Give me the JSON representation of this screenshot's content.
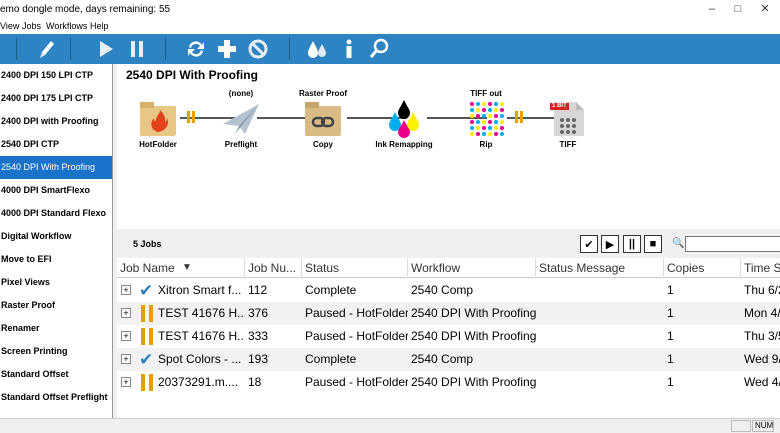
{
  "window": {
    "title": "emo dongle mode, days remaining: 55"
  },
  "menu": [
    "View",
    "Jobs",
    "Workflows",
    "Help"
  ],
  "workflows": [
    "2400 DPI 150 LPI CTP",
    "2400 DPI 175 LPI CTP",
    "2400 DPI with Proofing",
    "2540 DPI CTP",
    "2540 DPI With Proofing",
    "4000 DPI SmartFlexo",
    "4000 DPI Standard Flexo",
    "Digital Workflow",
    "Move to EFI",
    "Pixel Views",
    "Raster Proof",
    "Renamer",
    "Screen Printing",
    "Standard Offset",
    "Standard Offset Preflight"
  ],
  "selected_workflow": "2540 DPI With Proofing",
  "flow": {
    "title": "2540 DPI With Proofing",
    "nodes": [
      {
        "caption": "HotFolder",
        "label": "",
        "icon": "hotfolder-icon"
      },
      {
        "caption": "Preflight",
        "label": "(none)",
        "icon": "paper-plane-icon"
      },
      {
        "caption": "Copy",
        "label": "Raster Proof",
        "icon": "copy-link-icon"
      },
      {
        "caption": "Ink Remapping",
        "label": "",
        "icon": "ink-drops-icon"
      },
      {
        "caption": "Rip",
        "label": "TIFF out",
        "icon": "rip-grid-icon"
      },
      {
        "caption": "TIFF",
        "label": "",
        "icon": "tiff-file-icon",
        "badge": "1 BIT"
      }
    ]
  },
  "jobs": {
    "count_label": "5 Jobs",
    "columns": [
      "Job Name",
      "Job Nu...",
      "Status",
      "Workflow",
      "Status Message",
      "Copies",
      "Time St"
    ],
    "rows": [
      {
        "state": "check",
        "name": "Xitron Smart f...",
        "number": "112",
        "status": "Complete",
        "workflow": "2540 Comp",
        "message": "",
        "copies": "1",
        "time": "Thu 6/2"
      },
      {
        "state": "paused",
        "name": "TEST 41676 H...",
        "number": "376",
        "status": "Paused - HotFolder",
        "workflow": "2540 DPI With Proofing",
        "message": "",
        "copies": "1",
        "time": "Mon 4/"
      },
      {
        "state": "paused",
        "name": "TEST 41676 H...",
        "number": "333",
        "status": "Paused - HotFolder",
        "workflow": "2540 DPI With Proofing",
        "message": "",
        "copies": "1",
        "time": "Thu 3/5"
      },
      {
        "state": "check",
        "name": "Spot Colors - ...",
        "number": "193",
        "status": "Complete",
        "workflow": "2540 Comp",
        "message": "",
        "copies": "1",
        "time": "Wed 9/"
      },
      {
        "state": "paused",
        "name": "20373291.m....",
        "number": "18",
        "status": "Paused - HotFolder",
        "workflow": "2540 DPI With Proofing",
        "message": "",
        "copies": "1",
        "time": "Wed 4/"
      }
    ]
  },
  "statusbar": {
    "num": "NUM"
  },
  "colors": {
    "toolbar": "#2e83c2",
    "selection": "#1a73c9",
    "paused": "#e5a000",
    "check": "#2a7fbd"
  }
}
